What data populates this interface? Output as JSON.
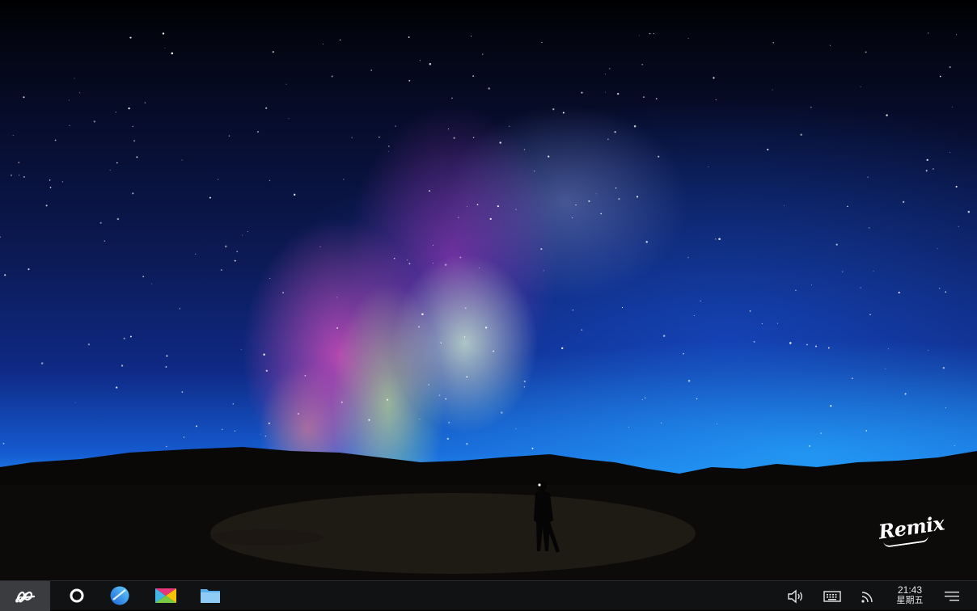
{
  "desktop": {
    "wallpaper_description": "",
    "watermark": "Remix"
  },
  "taskbar": {
    "start_icon": "remix-start-icon",
    "apps": [
      {
        "name": "cortana-circle-icon"
      },
      {
        "name": "browser-icon"
      },
      {
        "name": "store-icon"
      },
      {
        "name": "file-manager-icon"
      }
    ],
    "tray": {
      "volume_icon": "volume-icon",
      "keyboard_icon": "keyboard-icon",
      "network_icon": "network-icon"
    },
    "clock": {
      "time": "21:43",
      "day": "星期五"
    },
    "menu_icon": "notification-menu-icon"
  }
}
